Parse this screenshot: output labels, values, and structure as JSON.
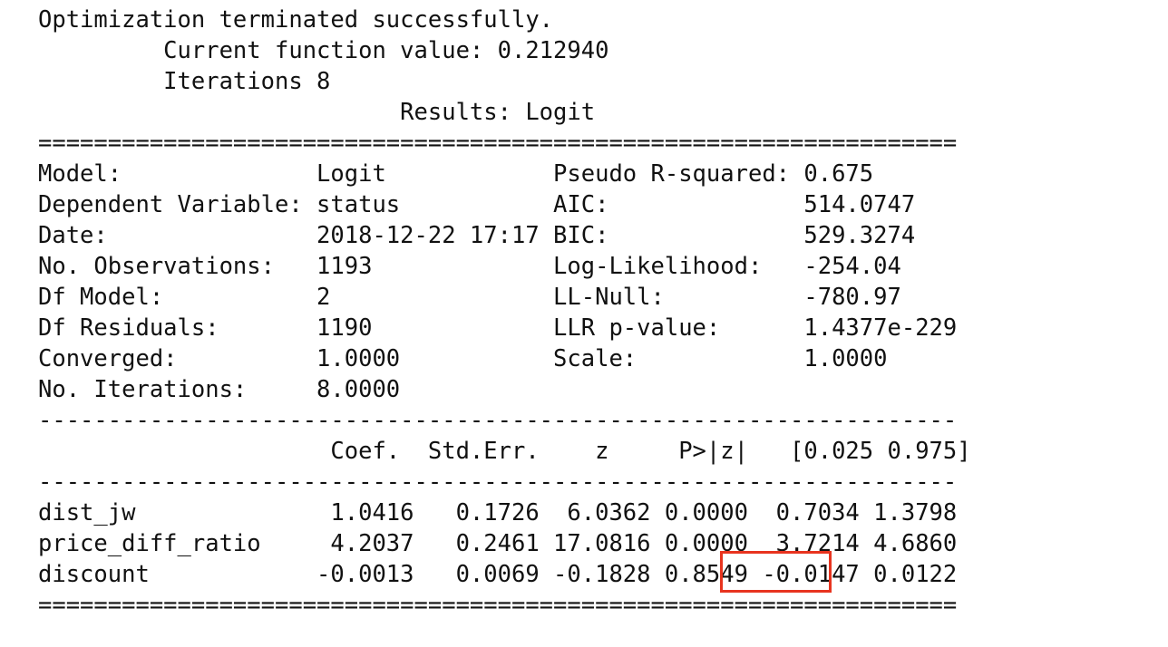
{
  "output": {
    "header_lines": [
      "Optimization terminated successfully.",
      "         Current function value: 0.212940",
      "         Iterations 8",
      "                          Results: Logit"
    ],
    "rule_double": "==================================================================",
    "info_lines": [
      "Model:              Logit            Pseudo R-squared: 0.675",
      "Dependent Variable: status           AIC:              514.0747",
      "Date:               2018-12-22 17:17 BIC:              529.3274",
      "No. Observations:   1193             Log-Likelihood:   -254.04",
      "Df Model:           2                LL-Null:          -780.97",
      "Df Residuals:       1190             LLR p-value:      1.4377e-229",
      "Converged:          1.0000           Scale:            1.0000",
      "No. Iterations:     8.0000"
    ],
    "rule_single": "------------------------------------------------------------------",
    "coef_header": "                     Coef.  Std.Err.    z     P>|z|   [0.025 0.975]",
    "coef_rows": [
      "dist_jw              1.0416   0.1726  6.0362 0.0000  0.7034 1.3798",
      "price_diff_ratio     4.2037   0.2461 17.0816 0.0000  3.7214 4.6860",
      "discount            -0.0013   0.0069 -0.1828 0.8549 -0.0147 0.0122"
    ]
  },
  "highlight": {
    "target": "discount P>|z|",
    "value": "0.8549",
    "color": "#e8341f"
  }
}
